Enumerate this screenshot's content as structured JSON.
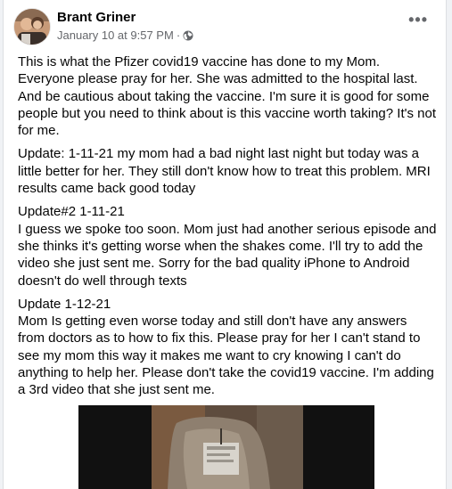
{
  "post": {
    "author": "Brant Griner",
    "date": "January 10 at 9:57 PM",
    "separator": "·",
    "privacy_icon": "globe-icon",
    "more_icon": "more-options-icon",
    "more_label": "•••",
    "paragraphs": [
      "This is what the Pfizer covid19 vaccine has done to my Mom. Everyone please pray for her. She was admitted to the hospital last. And be cautious about taking the vaccine. I'm sure it is good for some people but you need to think about is this vaccine worth taking? It's not for me.",
      "Update: 1-11-21 my mom had a bad night last night but today was a little better for her. They still don't know how to treat this problem. MRI results came back good today",
      "Update#2 1-11-21\nI guess we spoke too soon. Mom just had another serious episode and she thinks it's getting worse when the shakes come. I'll try to add the video she just sent me. Sorry for the bad quality iPhone to Android doesn't do well through texts",
      "Update 1-12-21\nMom Is getting even worse today and still don't have any answers from doctors as to how to fix this. Please pray for her I can't stand to see my mom this way it makes me want to cry knowing I can't do anything to help her. Please don't take the covid19 vaccine. I'm adding a 3rd video that she just sent me."
    ]
  }
}
